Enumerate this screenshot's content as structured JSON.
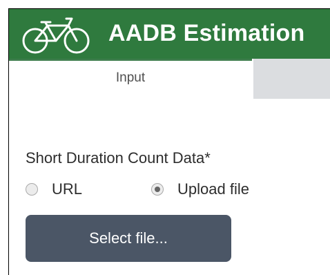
{
  "header": {
    "title": "AADB Estimation",
    "icon": "bicycle-icon",
    "background_color": "#2f7a3e"
  },
  "tabs": [
    {
      "label": "Input",
      "active": true
    },
    {
      "label": "",
      "active": false
    }
  ],
  "form": {
    "section_label": "Short Duration Count Data*",
    "source_options": [
      {
        "label": "URL",
        "selected": false
      },
      {
        "label": "Upload file",
        "selected": true
      }
    ],
    "select_file_label": "Select file...",
    "button_color": "#4b5666"
  }
}
